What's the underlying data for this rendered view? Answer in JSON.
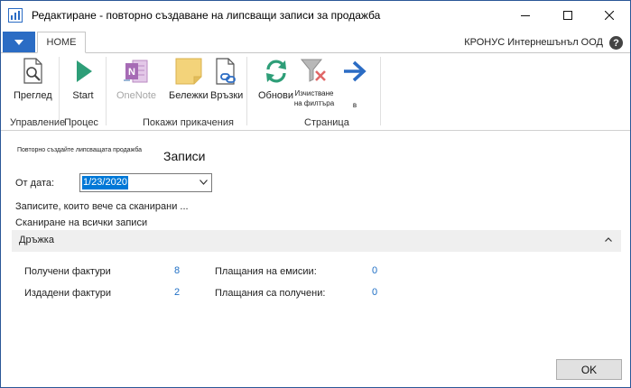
{
  "window": {
    "title": "Редактиране - повторно създаване на липсващи записи за продажба"
  },
  "ribbon": {
    "home_tab": "HOME",
    "company": "КРОНУС Интернешънъл ООД",
    "help": "?",
    "buttons": {
      "preview": "Преглед",
      "start": "Start",
      "onenote": "OneNote",
      "notes": "Бележки",
      "links": "Връзки",
      "refresh": "Обнови",
      "clear_filter": "Изчистване на филтъра",
      "goto": "в"
    },
    "groups": {
      "manage": "Управление",
      "process": "Процес",
      "show_attached": "Покажи прикачения",
      "page": "Страница"
    }
  },
  "page": {
    "breadcrumb": "Повторно създайте липсващата продажба",
    "heading": "Записи",
    "from_date_label": "От дата:",
    "from_date_value": "1/23/2020",
    "info_scanned": "Записите, които вече са сканирани ...",
    "info_scanning": "Сканиране на всички записи"
  },
  "section": {
    "title": "Дръжка",
    "fields": {
      "received_invoices_label": "Получени фактури",
      "received_invoices_value": "8",
      "issued_invoices_label": "Издадени фактури",
      "issued_invoices_value": "2",
      "payments_issued_label": "Плащания на емисии:",
      "payments_issued_value": "0",
      "payments_received_label": "Плащания са получени:",
      "payments_received_value": "0"
    }
  },
  "footer": {
    "ok_label": "OK"
  },
  "colors": {
    "accent": "#2b6cc4",
    "link_value": "#1f6fc5",
    "selection": "#0078d7"
  }
}
